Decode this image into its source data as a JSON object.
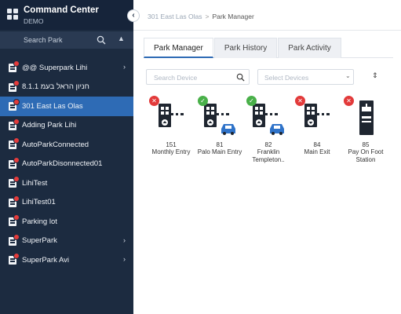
{
  "app": {
    "title": "Command Center",
    "subtitle": "DEMO"
  },
  "sidebar": {
    "search_placeholder": "Search Park",
    "items": [
      {
        "label": "@@ Superpark Lihi",
        "has_children": true,
        "selected": false
      },
      {
        "label": "חניון הראל בעמ 8.1.1",
        "has_children": false,
        "selected": false
      },
      {
        "label": "301 East Las Olas",
        "has_children": false,
        "selected": true
      },
      {
        "label": "Adding Park Lihi",
        "has_children": false,
        "selected": false
      },
      {
        "label": "AutoParkConnected",
        "has_children": false,
        "selected": false
      },
      {
        "label": "AutoParkDisonnected01",
        "has_children": false,
        "selected": false
      },
      {
        "label": "LihiTest",
        "has_children": false,
        "selected": false
      },
      {
        "label": "LihiTest01",
        "has_children": false,
        "selected": false
      },
      {
        "label": "Parking lot",
        "has_children": false,
        "selected": false
      },
      {
        "label": "SuperPark",
        "has_children": true,
        "selected": false
      },
      {
        "label": "SuperPark Avi",
        "has_children": true,
        "selected": false
      }
    ]
  },
  "breadcrumb": {
    "root": "301 East Las Olas",
    "separator": ">",
    "current": "Park Manager"
  },
  "tabs": [
    {
      "label": "Park Manager",
      "active": true
    },
    {
      "label": "Park History",
      "active": false
    },
    {
      "label": "Park Activity",
      "active": false
    }
  ],
  "filters": {
    "device_search_placeholder": "Search Device",
    "device_select_placeholder": "Select Devices"
  },
  "devices": [
    {
      "number": "151",
      "name": "Monthly Entry",
      "status": "error",
      "type": "entry-gate",
      "car": false
    },
    {
      "number": "81",
      "name": "Palo Main Entry",
      "status": "ok",
      "type": "entry-gate",
      "car": true
    },
    {
      "number": "82",
      "name": "Franklin Templeton..",
      "status": "ok",
      "type": "entry-gate",
      "car": true
    },
    {
      "number": "84",
      "name": "Main Exit",
      "status": "error",
      "type": "exit-gate",
      "car": false
    },
    {
      "number": "85",
      "name": "Pay On Foot Station",
      "status": "error",
      "type": "pay-station",
      "car": false
    }
  ],
  "colors": {
    "sidebar_bg": "#1c2b40",
    "selected_bg": "#2e6bb5",
    "status_ok": "#49b049",
    "status_error": "#e23a3a",
    "car": "#2f73c9"
  },
  "icons": {
    "search": "search-icon",
    "sort": "sort-icon",
    "collapse": "chevron-left-icon",
    "expand": "chevron-right-icon",
    "dropdown": "chevron-down-icon"
  }
}
